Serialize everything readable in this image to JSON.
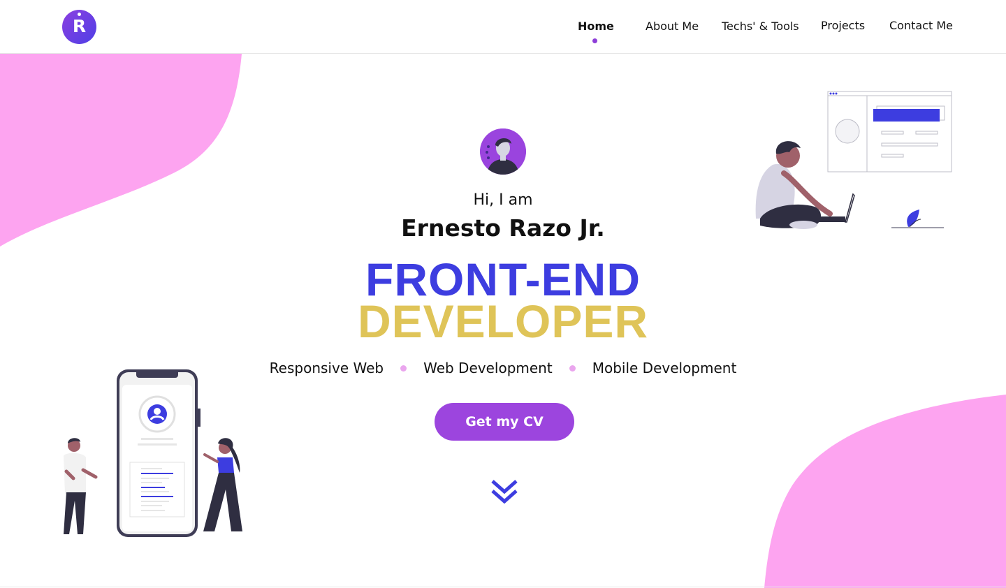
{
  "header": {
    "logo_letter": "R",
    "nav": [
      {
        "label": "Home",
        "active": true
      },
      {
        "label": "About Me",
        "active": false
      },
      {
        "label": "Techs' & Tools",
        "active": false
      },
      {
        "label": "Projects",
        "active": false
      },
      {
        "label": "Contact Me",
        "active": false
      }
    ]
  },
  "hero": {
    "greeting": "Hi, I am",
    "name": "Ernesto Razo Jr.",
    "title_line1": "FRONT-END",
    "title_line2": "DEVELOPER",
    "skills": [
      "Responsive Web",
      "Web Development",
      "Mobile Development"
    ],
    "cta_label": "Get my CV"
  },
  "colors": {
    "accent_purple": "#9c45de",
    "accent_blue": "#3d3de0",
    "accent_gold": "#dfc458",
    "blob_pink": "#fda4f0"
  },
  "icons": {
    "logo": "logo-icon",
    "scroll": "double-chevron-down-icon",
    "avatar": "avatar-icon"
  }
}
